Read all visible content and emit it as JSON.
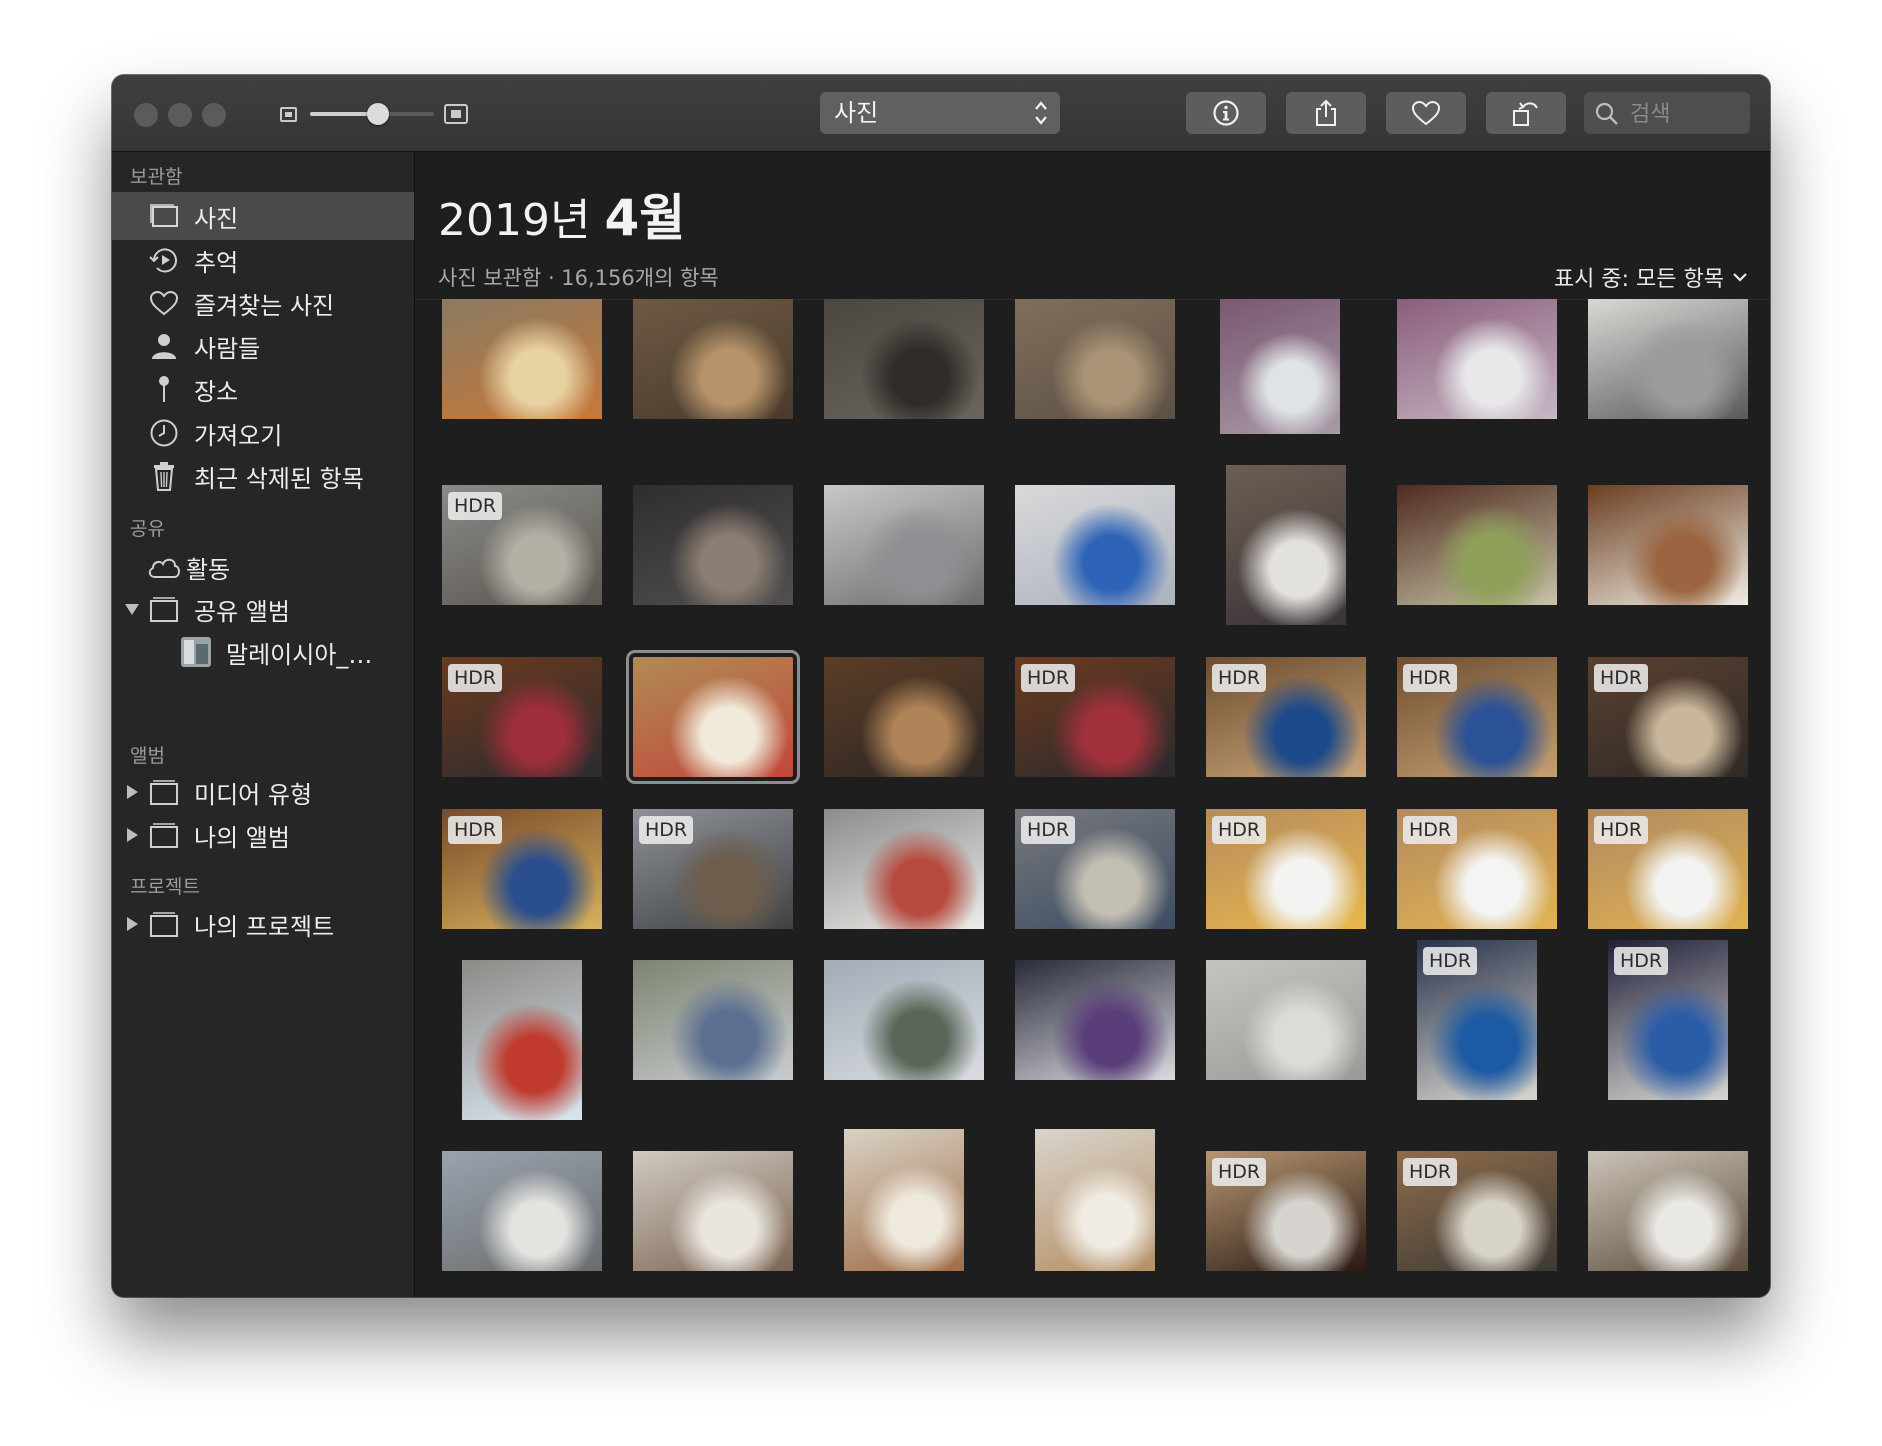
{
  "toolbar": {
    "view_select_value": "사진",
    "search_placeholder": "검색",
    "zoom_level": 0.55
  },
  "sidebar": {
    "sections": {
      "library": "보관함",
      "shared": "공유",
      "albums": "앨범",
      "projects": "프로젝트"
    },
    "library_items": [
      {
        "label": "사진",
        "icon": "photos-icon"
      },
      {
        "label": "추억",
        "icon": "memories-icon"
      },
      {
        "label": "즐겨찾는 사진",
        "icon": "heart-icon"
      },
      {
        "label": "사람들",
        "icon": "person-icon"
      },
      {
        "label": "장소",
        "icon": "pin-icon"
      },
      {
        "label": "가져오기",
        "icon": "clock-icon"
      },
      {
        "label": "최근 삭제된 항목",
        "icon": "trash-icon"
      }
    ],
    "shared_items": [
      {
        "label": "활동",
        "icon": "cloud-icon"
      },
      {
        "label": "공유 앨범",
        "icon": "album-icon"
      },
      {
        "label": "말레이시아_…",
        "icon": "album-thumbnail"
      }
    ],
    "album_items": [
      {
        "label": "미디어 유형",
        "icon": "album-icon"
      },
      {
        "label": "나의 앨범",
        "icon": "album-icon"
      }
    ],
    "project_items": [
      {
        "label": "나의 프로젝트",
        "icon": "album-icon"
      }
    ]
  },
  "main": {
    "title_year": "2019년",
    "title_month": "4월",
    "subtitle": "사진 보관함 · 16,156개의 항목",
    "showing": "표시 중: 모든 항목",
    "hdr_label": "HDR"
  },
  "photos": [
    {
      "hdr": false,
      "colors": [
        "#8a7a62",
        "#e9d2a2",
        "#c87838"
      ]
    },
    {
      "hdr": false,
      "colors": [
        "#6d5a44",
        "#b6936a",
        "#4a3a2c"
      ]
    },
    {
      "hdr": false,
      "colors": [
        "#4b4640",
        "#2f2b27",
        "#6a655e"
      ]
    },
    {
      "hdr": false,
      "colors": [
        "#7f6f5c",
        "#a99275",
        "#5d5045"
      ]
    },
    {
      "hdr": false,
      "colors": [
        "#7a5870",
        "#dfe3e6",
        "#a89aa8"
      ]
    },
    {
      "hdr": false,
      "colors": [
        "#8a5e7c",
        "#e8e8ea",
        "#c7b7c4"
      ]
    },
    {
      "hdr": false,
      "colors": [
        "#d9d8d4",
        "#9b9c9b",
        "#595a5c"
      ]
    },
    {
      "hdr": true,
      "colors": [
        "#8b8a86",
        "#b3b0a6",
        "#5b5751"
      ]
    },
    {
      "hdr": false,
      "colors": [
        "#2f2d30",
        "#8c7e72",
        "#51504f"
      ]
    },
    {
      "hdr": false,
      "colors": [
        "#c7c8c9",
        "#8d8f92",
        "#6c6d6a"
      ]
    },
    {
      "hdr": false,
      "colors": [
        "#d9d9d9",
        "#2d64b8",
        "#aab2c0"
      ]
    },
    {
      "hdr": false,
      "colors": [
        "#6d5e53",
        "#e3e1dd",
        "#3a3438"
      ]
    },
    {
      "hdr": false,
      "colors": [
        "#4f2b1f",
        "#8fa05a",
        "#c8c3a8"
      ]
    },
    {
      "hdr": false,
      "colors": [
        "#6b3e22",
        "#9a6540",
        "#efece2"
      ]
    },
    {
      "hdr": true,
      "colors": [
        "#6c3a1e",
        "#9d2e3a",
        "#2b2b30"
      ]
    },
    {
      "hdr": false,
      "colors": [
        "#b08b55",
        "#f1e9d9",
        "#c2473a"
      ]
    },
    {
      "hdr": false,
      "colors": [
        "#5b3d27",
        "#b08458",
        "#2d2724"
      ]
    },
    {
      "hdr": true,
      "colors": [
        "#6c3a1e",
        "#a0313b",
        "#2a2a2e"
      ]
    },
    {
      "hdr": true,
      "colors": [
        "#6e4d2f",
        "#1d4a8a",
        "#c7a47a"
      ]
    },
    {
      "hdr": true,
      "colors": [
        "#6f4e31",
        "#2b5296",
        "#c4a073"
      ]
    },
    {
      "hdr": true,
      "colors": [
        "#5a4030",
        "#c9b79c",
        "#2f2a26"
      ]
    },
    {
      "hdr": true,
      "colors": [
        "#7a4a2a",
        "#2b4f8e",
        "#d8b25d"
      ]
    },
    {
      "hdr": true,
      "colors": [
        "#8e9196",
        "#6d5d4d",
        "#3f4245"
      ]
    },
    {
      "hdr": false,
      "colors": [
        "#8d8c8d",
        "#b64a3e",
        "#ecece8"
      ]
    },
    {
      "hdr": true,
      "colors": [
        "#77787c",
        "#c4bfb3",
        "#3d4d63"
      ]
    },
    {
      "hdr": true,
      "colors": [
        "#b68b5e",
        "#f3f3f2",
        "#e8b84c"
      ]
    },
    {
      "hdr": true,
      "colors": [
        "#b48a5f",
        "#f4f4f3",
        "#e2b453"
      ]
    },
    {
      "hdr": true,
      "colors": [
        "#b08a60",
        "#f3f3f2",
        "#e1b252"
      ]
    },
    {
      "hdr": false,
      "colors": [
        "#8d8a86",
        "#c03a2e",
        "#d9e6f0"
      ]
    },
    {
      "hdr": false,
      "colors": [
        "#7d8470",
        "#5d7092",
        "#c8ccd0"
      ]
    },
    {
      "hdr": false,
      "colors": [
        "#a3abb5",
        "#5b6658",
        "#d9dde2"
      ]
    },
    {
      "hdr": false,
      "colors": [
        "#282b3a",
        "#5a3e7a",
        "#d9d9de"
      ]
    },
    {
      "hdr": false,
      "colors": [
        "#c5c4c1",
        "#dcdbd8",
        "#9a9996"
      ]
    },
    {
      "hdr": true,
      "colors": [
        "#28324a",
        "#1c5aa3",
        "#d7d5cf"
      ]
    },
    {
      "hdr": true,
      "colors": [
        "#20213a",
        "#2a5ca8",
        "#d7d6d2"
      ]
    },
    {
      "hdr": false,
      "colors": [
        "#9aa2ad",
        "#e3e3e0",
        "#6a6d6f"
      ]
    },
    {
      "hdr": false,
      "colors": [
        "#cfcac1",
        "#e9e6df",
        "#7d6553"
      ]
    },
    {
      "hdr": false,
      "colors": [
        "#d8d2c4",
        "#efe9dd",
        "#a06d48"
      ]
    },
    {
      "hdr": false,
      "colors": [
        "#d8d4cb",
        "#f0ece4",
        "#b58f65"
      ]
    },
    {
      "hdr": true,
      "colors": [
        "#b69673",
        "#d7d4cf",
        "#2a1a12"
      ]
    },
    {
      "hdr": true,
      "colors": [
        "#8d6c4b",
        "#d8d3c8",
        "#3d3a35"
      ]
    },
    {
      "hdr": false,
      "colors": [
        "#cac3b6",
        "#eae8e4",
        "#5e4e3e"
      ]
    }
  ]
}
